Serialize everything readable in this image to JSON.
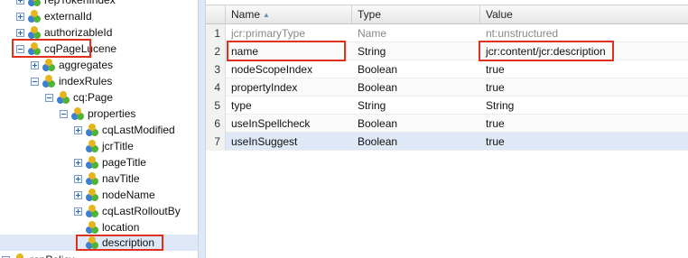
{
  "colors": {
    "highlight": "#e0301e",
    "selection": "#dfe8f6"
  },
  "tree": {
    "nodes": [
      {
        "label": "repTokenIndex",
        "icon": "node-icon",
        "expander": "plus"
      },
      {
        "label": "externalId",
        "icon": "node-icon",
        "expander": "plus"
      },
      {
        "label": "authorizableId",
        "icon": "node-icon",
        "expander": "plus"
      },
      {
        "label": "cqPageLucene",
        "icon": "node-icon",
        "expander": "minus",
        "highlighted": true
      },
      {
        "label": "aggregates",
        "icon": "node-icon",
        "expander": "plus"
      },
      {
        "label": "indexRules",
        "icon": "node-icon",
        "expander": "minus"
      },
      {
        "label": "cq:Page",
        "icon": "node-icon",
        "expander": "minus"
      },
      {
        "label": "properties",
        "icon": "node-icon",
        "expander": "minus"
      },
      {
        "label": "cqLastModified",
        "icon": "node-icon",
        "expander": "plus"
      },
      {
        "label": "jcrTitle",
        "icon": "node-icon",
        "expander": "none"
      },
      {
        "label": "pageTitle",
        "icon": "node-icon",
        "expander": "plus"
      },
      {
        "label": "navTitle",
        "icon": "node-icon",
        "expander": "plus"
      },
      {
        "label": "nodeName",
        "icon": "node-icon",
        "expander": "plus"
      },
      {
        "label": "cqLastRolloutBy",
        "icon": "node-icon",
        "expander": "plus"
      },
      {
        "label": "location",
        "icon": "node-icon",
        "expander": "none"
      },
      {
        "label": "description",
        "icon": "node-icon",
        "expander": "none",
        "selected": true,
        "highlighted": true
      },
      {
        "label": "repPolicy",
        "icon": "node-icon",
        "expander": "plus"
      }
    ]
  },
  "grid": {
    "columns": [
      {
        "label": "Name",
        "sorted": "ascending"
      },
      {
        "label": "Type"
      },
      {
        "label": "Value"
      }
    ],
    "rows": [
      {
        "num": "1",
        "name": "jcr:primaryType",
        "type": "Name",
        "value": "nt:unstructured",
        "faded": true
      },
      {
        "num": "2",
        "name": "name",
        "type": "String",
        "value": "jcr:content/jcr:description",
        "highlighted": true
      },
      {
        "num": "3",
        "name": "nodeScopeIndex",
        "type": "Boolean",
        "value": "true"
      },
      {
        "num": "4",
        "name": "propertyIndex",
        "type": "Boolean",
        "value": "true"
      },
      {
        "num": "5",
        "name": "type",
        "type": "String",
        "value": "String"
      },
      {
        "num": "6",
        "name": "useInSpellcheck",
        "type": "Boolean",
        "value": "true"
      },
      {
        "num": "7",
        "name": "useInSuggest",
        "type": "Boolean",
        "value": "true",
        "selected": true
      }
    ]
  }
}
